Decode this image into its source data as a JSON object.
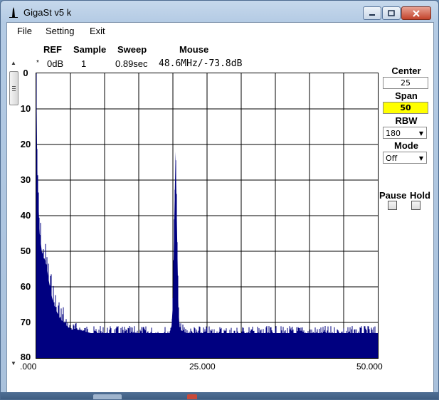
{
  "window": {
    "title": "GigaSt v5 k"
  },
  "menu": [
    "File",
    "Setting",
    "Exit"
  ],
  "info": {
    "headers": {
      "ref": "REF",
      "sample": "Sample",
      "sweep": "Sweep",
      "mouse": "Mouse"
    },
    "values": {
      "marker": "*",
      "ref": "0dB",
      "sample": "1",
      "sweep": "0.89sec",
      "mouse": "48.6MHz/-73.8dB"
    }
  },
  "controls": {
    "center": {
      "label": "Center",
      "value": "25"
    },
    "span": {
      "label": "Span",
      "value": "50",
      "highlight": "#ffff00"
    },
    "rbw": {
      "label": "RBW",
      "value": "180"
    },
    "mode": {
      "label": "Mode",
      "value": "Off"
    },
    "pause": {
      "label": "Pause",
      "checked": false
    },
    "hold": {
      "label": "Hold",
      "checked": false
    }
  },
  "colors": {
    "trace": "#000080"
  },
  "chart_data": {
    "type": "area",
    "x_tick_labels": [
      ".000",
      "25.000",
      "50.000"
    ],
    "y_tick_labels": [
      "0",
      "10",
      "20",
      "30",
      "40",
      "50",
      "60",
      "70",
      "80"
    ],
    "xlim": [
      0,
      50
    ],
    "ylim": [
      0,
      80
    ],
    "y_inverted": true,
    "grid": true,
    "series": [
      {
        "x": [
          0,
          0.1,
          0.2,
          0.3,
          0.5,
          0.8,
          1.0,
          1.2,
          1.5,
          1.8,
          2.0,
          2.3,
          2.6,
          3.0,
          3.5,
          4.0,
          4.5,
          5.0,
          6.0,
          8.0,
          10.0,
          12.0,
          15.0,
          18.0,
          19.5,
          19.8,
          20.0,
          20.2,
          20.4,
          20.6,
          20.8,
          21.0,
          22.0,
          25.0,
          30.0,
          35.0,
          40.0,
          45.0,
          50.0
        ],
        "y": [
          0,
          20,
          33,
          36,
          45,
          50,
          52,
          52,
          54,
          58,
          60,
          63,
          65,
          67,
          69,
          70,
          71,
          72,
          72,
          73,
          73,
          73,
          73,
          73,
          73,
          71,
          65,
          42,
          22,
          44,
          66,
          72,
          73,
          73,
          73,
          73,
          73,
          73,
          73
        ]
      }
    ]
  }
}
